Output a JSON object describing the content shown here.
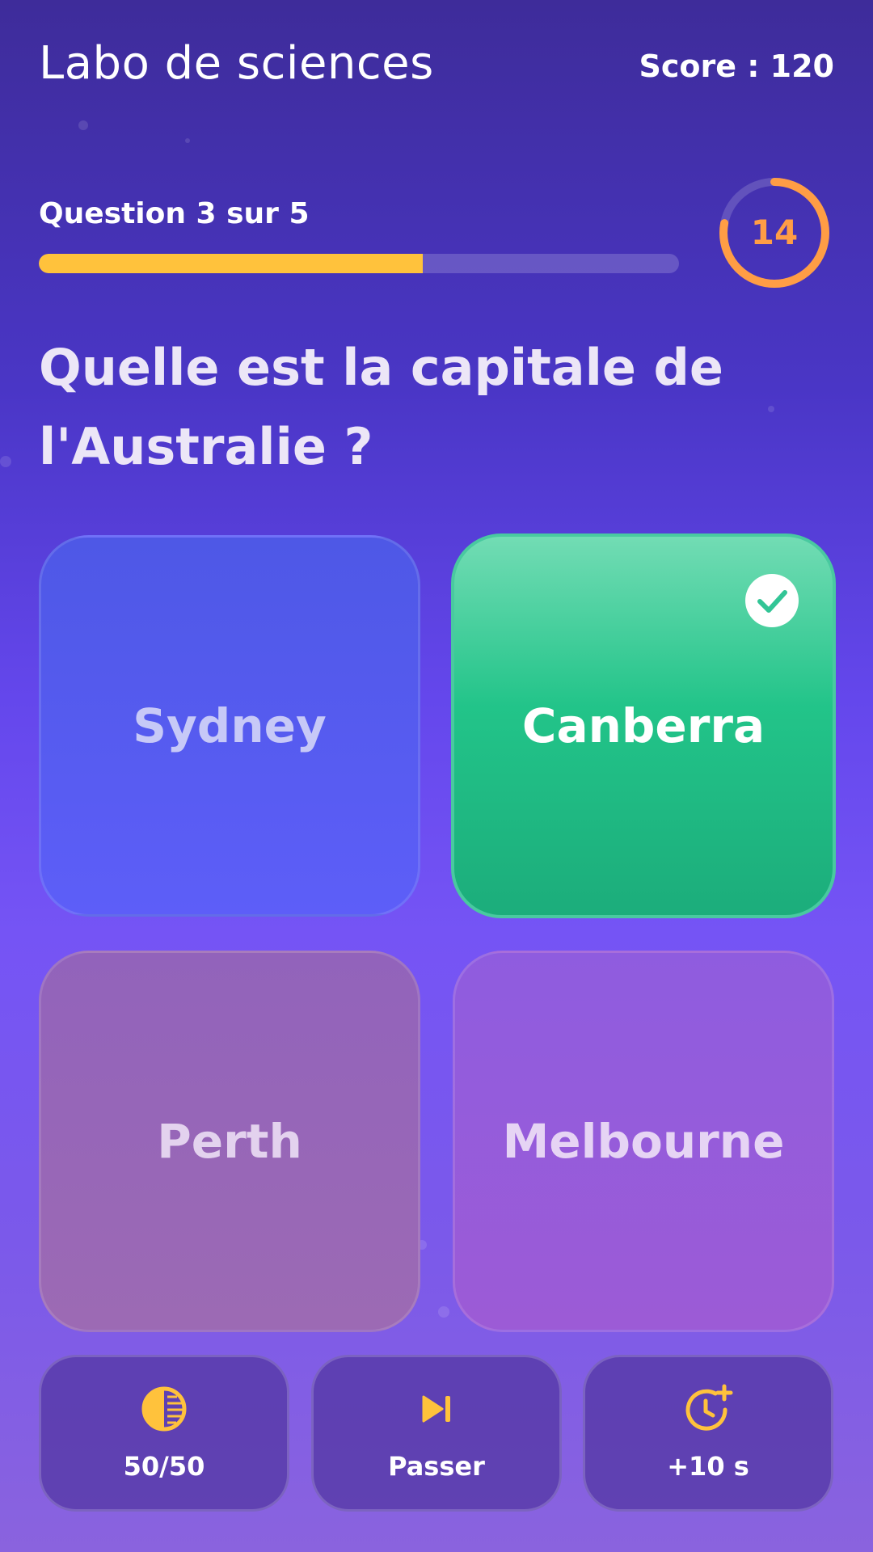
{
  "header": {
    "title": "Labo de sciences",
    "score": "Score : 120"
  },
  "progress": {
    "label": "Question 3 sur 5",
    "fraction": 0.6
  },
  "timer": {
    "value": "14",
    "remaining_fraction": 0.78,
    "color": "#ff9d45"
  },
  "question": {
    "text": "Quelle est la capitale de l'Australie ?"
  },
  "answers": [
    {
      "label": "Sydney",
      "state": "default",
      "color": "#5a5cf0"
    },
    {
      "label": "Canberra",
      "state": "correct-selected",
      "color": "#22c489",
      "icon": "check-icon"
    },
    {
      "label": "Perth",
      "state": "dimmed",
      "color": "#9865b8"
    },
    {
      "label": "Melbourne",
      "state": "dimmed",
      "color": "#965cdb"
    }
  ],
  "lifelines": [
    {
      "label": "50/50",
      "icon": "half-circle-icon"
    },
    {
      "label": "Passer",
      "icon": "skip-next-icon"
    },
    {
      "label": "+10 s",
      "icon": "timer-plus-icon"
    }
  ],
  "colors": {
    "accent": "#ffc23c",
    "correct": "#22c489"
  }
}
